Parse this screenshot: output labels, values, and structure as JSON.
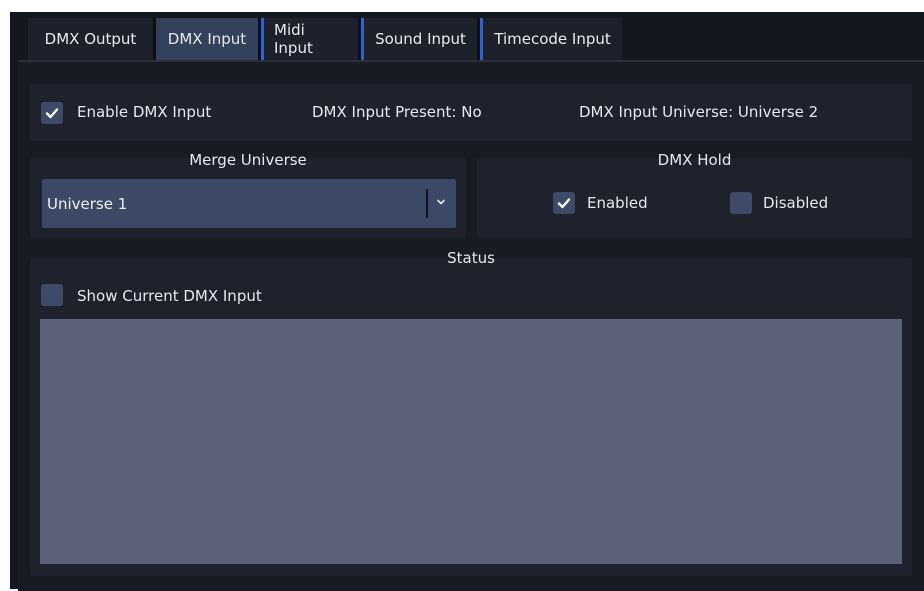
{
  "tabs": [
    {
      "label": "DMX Output"
    },
    {
      "label": "DMX Input"
    },
    {
      "label": "Midi Input"
    },
    {
      "label": "Sound Input"
    },
    {
      "label": "Timecode Input"
    }
  ],
  "top_row": {
    "enable_label": "Enable DMX Input",
    "enable_checked": true,
    "present_text": "DMX Input Present: No",
    "universe_text": "DMX Input Universe: Universe 2"
  },
  "merge": {
    "title": "Merge Universe",
    "selected": "Universe 1"
  },
  "hold": {
    "title": "DMX Hold",
    "enabled_label": "Enabled",
    "enabled_checked": true,
    "disabled_label": "Disabled",
    "disabled_checked": false
  },
  "status": {
    "title": "Status",
    "show_label": "Show Current DMX Input",
    "show_checked": false
  },
  "colors": {
    "accent": "#2e62d6",
    "checkbox": "#3d4a68",
    "panel": "#1d222c"
  }
}
